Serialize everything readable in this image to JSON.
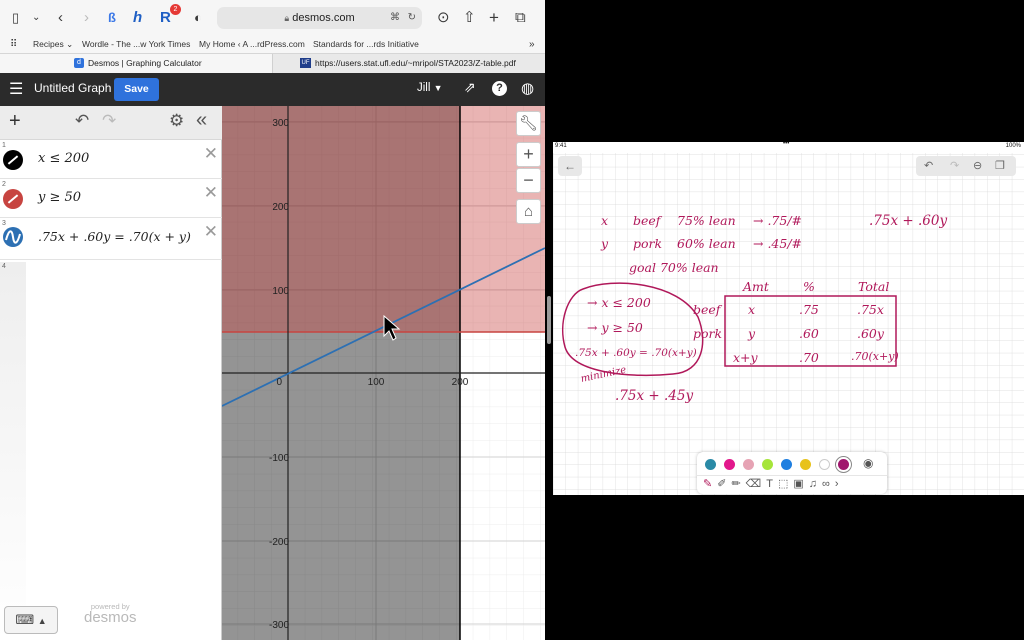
{
  "safari": {
    "url": "desmos.com",
    "notification_count": "2",
    "favorites": [
      "Recipes ⌄",
      "Wordle - The ...w York Times",
      "My Home ‹ A ...rdPress.com",
      "Standards for ...rds Initiative"
    ],
    "tabs": [
      {
        "label": "Desmos | Graphing Calculator",
        "favicon": "d"
      },
      {
        "label": "https://users.stat.ufl.edu/~mripol/STA2023/Z-table.pdf",
        "favicon": "UF"
      }
    ]
  },
  "desmos": {
    "title": "Untitled Graph",
    "save_label": "Save",
    "user": "Jill",
    "expressions": [
      {
        "num": "1",
        "latex": "x ≤ 200",
        "color": "#000000"
      },
      {
        "num": "2",
        "latex": "y ≥ 50",
        "color": "#c74440"
      },
      {
        "num": "3",
        "latex": ".75x + .60y = .70(x + y)",
        "color": "#2d70b3"
      }
    ],
    "empty_num": "4",
    "powered_by": "powered by",
    "brand": "desmos",
    "graph": {
      "x_ticks": [
        "0",
        "100",
        "200"
      ],
      "y_ticks": [
        "300",
        "200",
        "100",
        "-100",
        "-200",
        "-300"
      ]
    }
  },
  "ipad": {
    "time": "9:41",
    "battery": "100%",
    "palette_colors": [
      "#2a8aa6",
      "#e2188c",
      "#e6a3b4",
      "#a6e53a",
      "#1e7fe0",
      "#e8c21a",
      "#ffffff",
      "#a0166d"
    ],
    "notes": {
      "row_x": {
        "var": "x",
        "meat": "beef",
        "pct": "75% lean",
        "arrow": "→ .75/#"
      },
      "row_y": {
        "var": "y",
        "meat": "pork",
        "pct": "60% lean",
        "arrow": "→ .45/#"
      },
      "goal": "goal   70% lean",
      "cost": ".75x + .60y",
      "table_headers": [
        "Amt",
        "%",
        "Total"
      ],
      "table_rows": [
        {
          "label": "beef",
          "amt": "x",
          "pct": ".75",
          "total": ".75x"
        },
        {
          "label": "pork",
          "amt": "y",
          "pct": ".60",
          "total": ".60y"
        },
        {
          "label": "",
          "amt": "x+y",
          "pct": ".70",
          "total": ".70(x+y)"
        }
      ],
      "constraints": [
        "→ x ≤ 200",
        "→ y ≥ 50",
        ".75x + .60y = .70(x+y)"
      ],
      "minimize_label": "minimize",
      "objective": ".75x + .45y"
    }
  }
}
